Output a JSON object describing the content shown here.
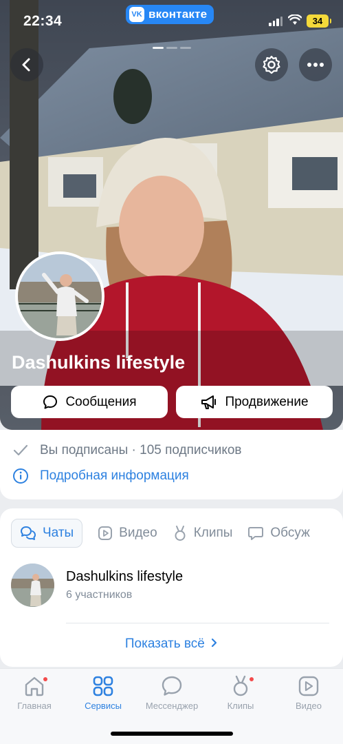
{
  "status_bar": {
    "time": "22:34",
    "app_badge": "вконтакте",
    "vk_logo": "VK",
    "battery": "34"
  },
  "colors": {
    "accent": "#2d81e0",
    "vk_blue": "#2787f5",
    "notification": "#f34b4b",
    "battery": "#f4d93a"
  },
  "header": {
    "back_icon": "chevron-left-icon",
    "settings_icon": "gear-icon",
    "more_icon": "more-horizontal-icon",
    "cover_pages": 3,
    "current_cover_page": 1
  },
  "profile": {
    "name": "Dashulkins lifestyle",
    "message_button": "Сообщения",
    "promote_button": "Продвижение"
  },
  "info": {
    "subscription": "Вы подписаны · 105 подписчиков",
    "details_link": "Подробная информация"
  },
  "content_tabs": [
    {
      "label": "Чаты",
      "icon": "chat-icon",
      "active": true
    },
    {
      "label": "Видео",
      "icon": "video-icon",
      "active": false
    },
    {
      "label": "Клипы",
      "icon": "clips-icon",
      "active": false
    },
    {
      "label": "Обсуж",
      "icon": "discussion-icon",
      "active": false
    }
  ],
  "chats": [
    {
      "title": "Dashulkins lifestyle",
      "subtitle": "6 участников"
    }
  ],
  "show_all": "Показать всё",
  "bottom_nav": [
    {
      "label": "Главная",
      "icon": "home-icon",
      "active": false,
      "badge": true
    },
    {
      "label": "Сервисы",
      "icon": "services-icon",
      "active": true,
      "badge": false
    },
    {
      "label": "Мессенджер",
      "icon": "messenger-icon",
      "active": false,
      "badge": false
    },
    {
      "label": "Клипы",
      "icon": "clips-icon",
      "active": false,
      "badge": true
    },
    {
      "label": "Видео",
      "icon": "video-icon",
      "active": false,
      "badge": false
    }
  ]
}
